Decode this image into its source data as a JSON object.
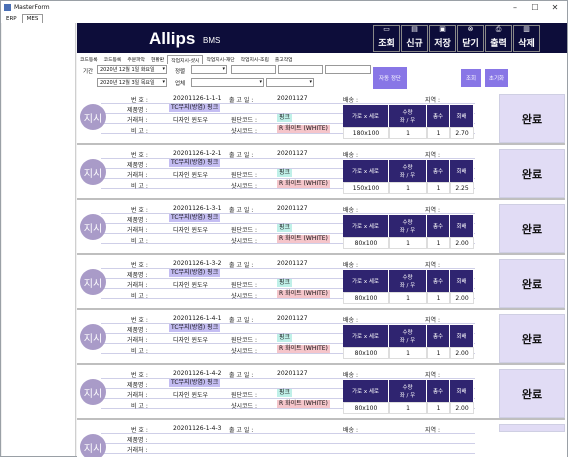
{
  "window": {
    "title": "MasterForm"
  },
  "menu": [
    "ERP",
    "MES"
  ],
  "header": {
    "brand": "Allips",
    "brand_sub": "BMS",
    "toolbar": [
      {
        "label": "조회",
        "icon": "monitor-icon"
      },
      {
        "label": "신규",
        "icon": "new-document-icon"
      },
      {
        "label": "저장",
        "icon": "save-icon"
      },
      {
        "label": "닫기",
        "icon": "close-circle-icon"
      },
      {
        "label": "출력",
        "icon": "print-icon"
      },
      {
        "label": "삭제",
        "icon": "trash-icon"
      }
    ]
  },
  "tabs": [
    "코드등록",
    "코드등록",
    "주문파악",
    "현황판",
    "작업지시-샷시",
    "작업지시-재단",
    "작업지시-조립",
    "출고작업"
  ],
  "active_tab": 4,
  "filters": {
    "period_label": "기간",
    "date_from": "2020년 12월  1일 화요일",
    "date_to": "2020년 12월  3일 목요일",
    "status_label": "정렬",
    "order_label": "업체",
    "auto_btn": "자동 정단",
    "search_btn": "조회",
    "reset_btn": "초기화"
  },
  "labels": {
    "no": "번  호 :",
    "product": "제품명 :",
    "client": "거래처 :",
    "note": "비  고 :",
    "ship_date": "출 고 일 :",
    "base_code": "원단코드 :",
    "sash_code": "샷시코드 :",
    "delivery": "배송 :",
    "region": "지역 :",
    "size_h": "가로 x 세로",
    "qty_h": "수량",
    "qty_sub": "좌 / 우",
    "total_h": "총수",
    "ratio_h": "회배",
    "badge": "지시",
    "status": "완료"
  },
  "orders": [
    {
      "no": "20201126-1-1-1",
      "product": "TC무지(방염) 핑크",
      "client": "디자인 윈도우",
      "ship": "20201127",
      "base": "핑크",
      "sash": "R 화이트 (WHITE)",
      "size": "180x100",
      "qty": "1",
      "total": "1",
      "ratio": "2.70"
    },
    {
      "no": "20201126-1-2-1",
      "product": "TC무지(방염) 핑크",
      "client": "디자인 윈도우",
      "ship": "20201127",
      "base": "핑크",
      "sash": "R 화이트 (WHITE)",
      "size": "150x100",
      "qty": "1",
      "total": "1",
      "ratio": "2.25"
    },
    {
      "no": "20201126-1-3-1",
      "product": "TC무지(방염) 핑크",
      "client": "디자인 윈도우",
      "ship": "20201127",
      "base": "핑크",
      "sash": "R 화이트 (WHITE)",
      "size": "80x100",
      "qty": "1",
      "total": "1",
      "ratio": "2.00"
    },
    {
      "no": "20201126-1-3-2",
      "product": "TC무지(방염) 핑크",
      "client": "디자인 윈도우",
      "ship": "20201127",
      "base": "핑크",
      "sash": "R 화이트 (WHITE)",
      "size": "80x100",
      "qty": "1",
      "total": "1",
      "ratio": "2.00"
    },
    {
      "no": "20201126-1-4-1",
      "product": "TC무지(방염) 핑크",
      "client": "디자인 윈도우",
      "ship": "20201127",
      "base": "핑크",
      "sash": "R 화이트 (WHITE)",
      "size": "80x100",
      "qty": "1",
      "total": "1",
      "ratio": "2.00"
    },
    {
      "no": "20201126-1-4-2",
      "product": "TC무지(방염) 핑크",
      "client": "디자인 윈도우",
      "ship": "20201127",
      "base": "핑크",
      "sash": "R 화이트 (WHITE)",
      "size": "80x100",
      "qty": "1",
      "total": "1",
      "ratio": "2.00"
    },
    {
      "no": "20201126-1-4-3",
      "product": "",
      "client": "",
      "ship": "",
      "base": "",
      "sash": "",
      "size": "",
      "qty": "",
      "total": "",
      "ratio": ""
    }
  ]
}
